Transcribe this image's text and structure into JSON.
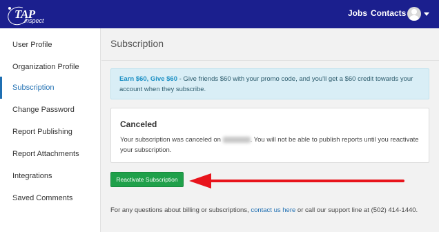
{
  "brand": {
    "logo_main": "TAP",
    "logo_sub": "inspect"
  },
  "topnav": {
    "jobs": "Jobs",
    "contacts": "Contacts"
  },
  "sidebar": {
    "items": [
      {
        "label": "User Profile"
      },
      {
        "label": "Organization Profile"
      },
      {
        "label": "Subscription"
      },
      {
        "label": "Change Password"
      },
      {
        "label": "Report Publishing"
      },
      {
        "label": "Report Attachments"
      },
      {
        "label": "Integrations"
      },
      {
        "label": "Saved Comments"
      }
    ],
    "active": "Subscription"
  },
  "main": {
    "title": "Subscription",
    "promo": {
      "highlight": "Earn $60, Give $60",
      "text": " - Give friends $60 with your promo code, and you'll get a $60 credit towards your account when they subscribe."
    },
    "status_card": {
      "title": "Canceled",
      "text_before": "Your subscription was canceled on ",
      "text_after": ". You will not be able to publish reports until you reactivate your subscription."
    },
    "reactivate_label": "Reactivate Subscription",
    "footer": {
      "before": "For any questions about billing or subscriptions, ",
      "link": "contact us here",
      "after": " or call our support line at (502) 414-1440."
    }
  },
  "colors": {
    "topbar": "#1b1f8e",
    "accent": "#1f6fb2",
    "button": "#1fa04a",
    "arrow": "#e8141c"
  }
}
